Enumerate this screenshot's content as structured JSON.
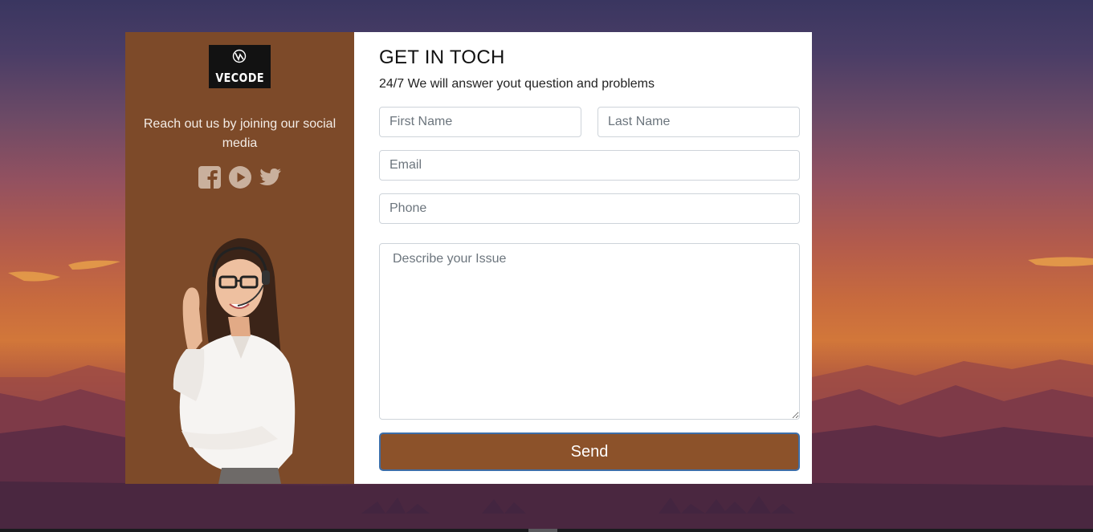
{
  "brand": {
    "logo_text": "VECODE",
    "tagline": "Reach out us by joining our social media"
  },
  "socials": [
    {
      "icon": "facebook-icon"
    },
    {
      "icon": "youtube-icon"
    },
    {
      "icon": "twitter-icon"
    }
  ],
  "form": {
    "title": "GET IN TOCH",
    "subtitle": "24/7 We will answer yout question and problems",
    "first_name_placeholder": "First Name",
    "last_name_placeholder": "Last Name",
    "email_placeholder": "Email",
    "phone_placeholder": "Phone",
    "issue_placeholder": "Describe your Issue",
    "send_label": "Send"
  },
  "colors": {
    "panel_brown": "#7d4a29",
    "button_brown": "#8c522a",
    "button_border": "#3d6ea8",
    "icon_color": "#c9b09d"
  }
}
